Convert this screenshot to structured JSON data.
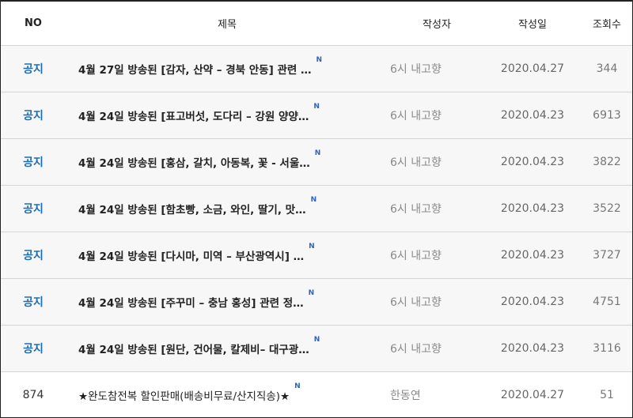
{
  "table": {
    "headers": {
      "no": "NO",
      "title": "제목",
      "author": "작성자",
      "date": "작성일",
      "views": "조회수"
    },
    "rows": [
      {
        "no": "공지",
        "title": "4월 27일 방송된 [감자, 산약 – 경북 안동] 관련 …",
        "badge": "N",
        "author": "6시 내고향",
        "date": "2020.04.27",
        "views": "344"
      },
      {
        "no": "공지",
        "title": "4월 24일 방송된 [표고버섯, 도다리 – 강원 양양…",
        "badge": "N",
        "author": "6시 내고향",
        "date": "2020.04.23",
        "views": "6913"
      },
      {
        "no": "공지",
        "title": "4월 24일 방송된 [홍삼, 갈치, 아동복, 꽃 - 서울…",
        "badge": "N",
        "author": "6시 내고향",
        "date": "2020.04.23",
        "views": "3822"
      },
      {
        "no": "공지",
        "title": "4월 24일 방송된 [함초빵, 소금, 와인, 딸기, 맛…",
        "badge": "N",
        "author": "6시 내고향",
        "date": "2020.04.23",
        "views": "3522"
      },
      {
        "no": "공지",
        "title": "4월 24일 방송된 [다시마, 미역 – 부산광역시] …",
        "badge": "N",
        "author": "6시 내고향",
        "date": "2020.04.23",
        "views": "3727"
      },
      {
        "no": "공지",
        "title": "4월 24일 방송된 [주꾸미 – 충남 홍성] 관련 정…",
        "badge": "N",
        "author": "6시 내고향",
        "date": "2020.04.23",
        "views": "4751"
      },
      {
        "no": "공지",
        "title": "4월 24일 방송된 [원단, 건어물, 칼제비– 대구광…",
        "badge": "N",
        "author": "6시 내고향",
        "date": "2020.04.23",
        "views": "3116"
      },
      {
        "no": "874",
        "title": "★완도참전복 할인판매(배송비무료/산지직송)★",
        "badge": "N",
        "author": "한동연",
        "date": "2020.04.27",
        "views": "51"
      }
    ]
  },
  "colors": {
    "notice_label": "#1a6fb3",
    "new_badge": "#2f62c5",
    "notice_row_bg": "#f7f7f7"
  }
}
